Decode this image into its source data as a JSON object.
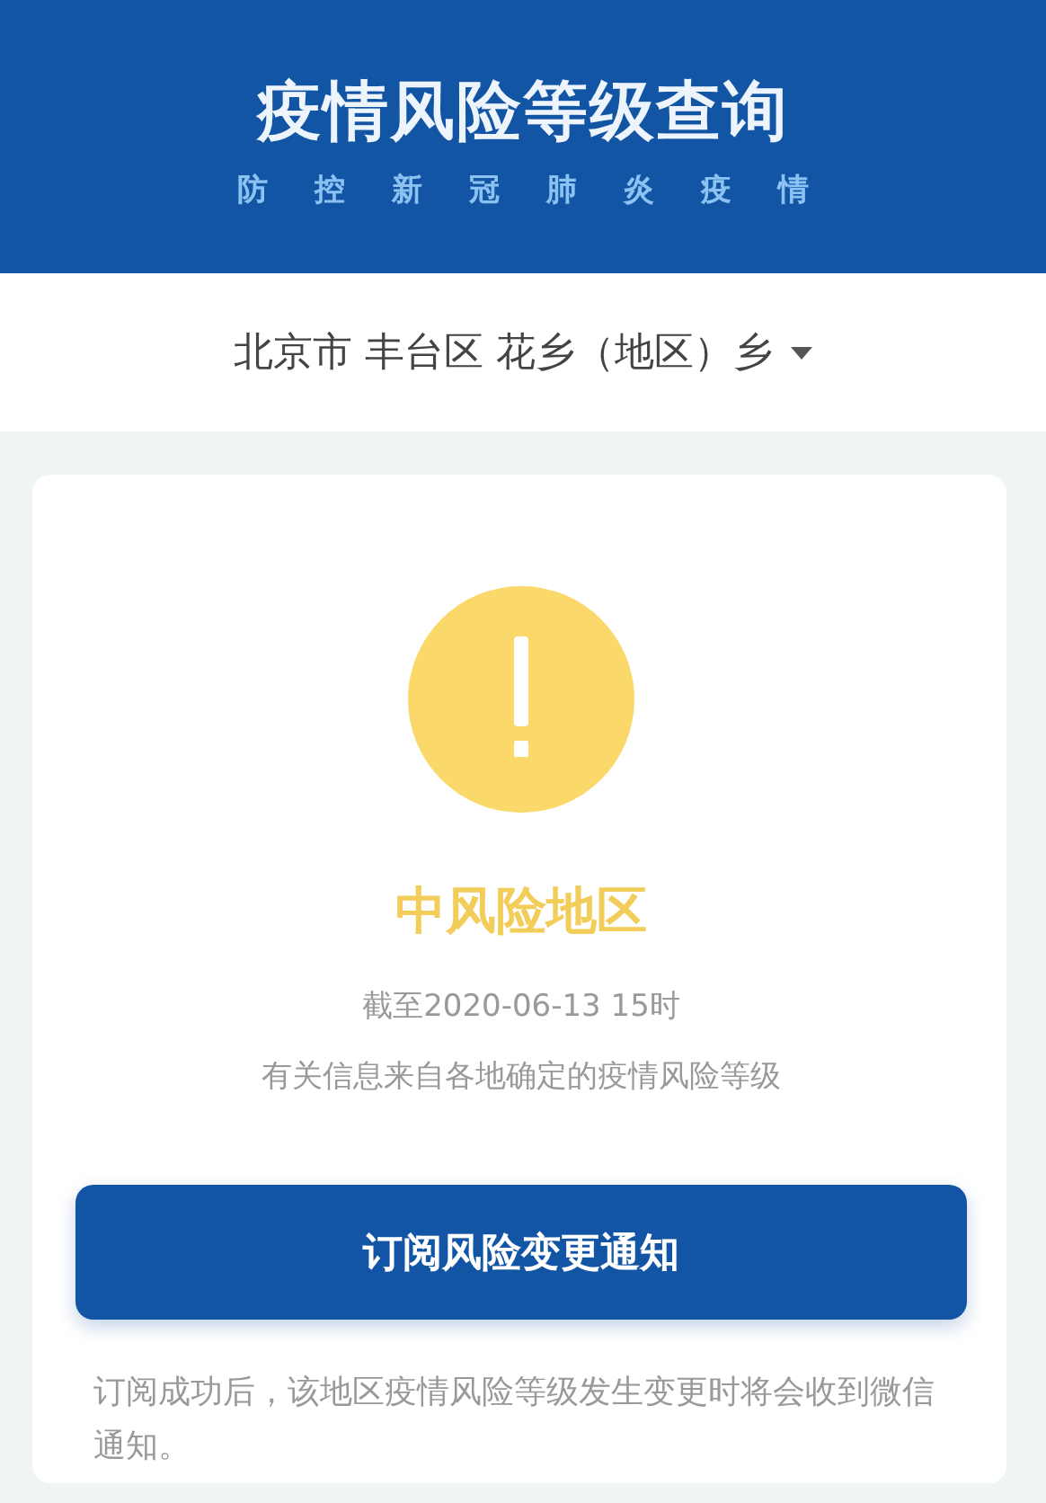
{
  "header": {
    "title": "疫情风险等级查询",
    "subtitle": "防控新冠肺炎疫情"
  },
  "location": {
    "value": "北京市 丰台区 花乡（地区）乡"
  },
  "result": {
    "kind": "medium",
    "level_label": "中风险地区",
    "as_of": "截至2020-06-13 15时",
    "source_note": "有关信息来自各地确定的疫情风险等级"
  },
  "subscribe_button": {
    "label": "订阅风险变更通知"
  },
  "footnote": "订阅成功后，该地区疫情风险等级发生变更时将会收到微信通知。"
}
